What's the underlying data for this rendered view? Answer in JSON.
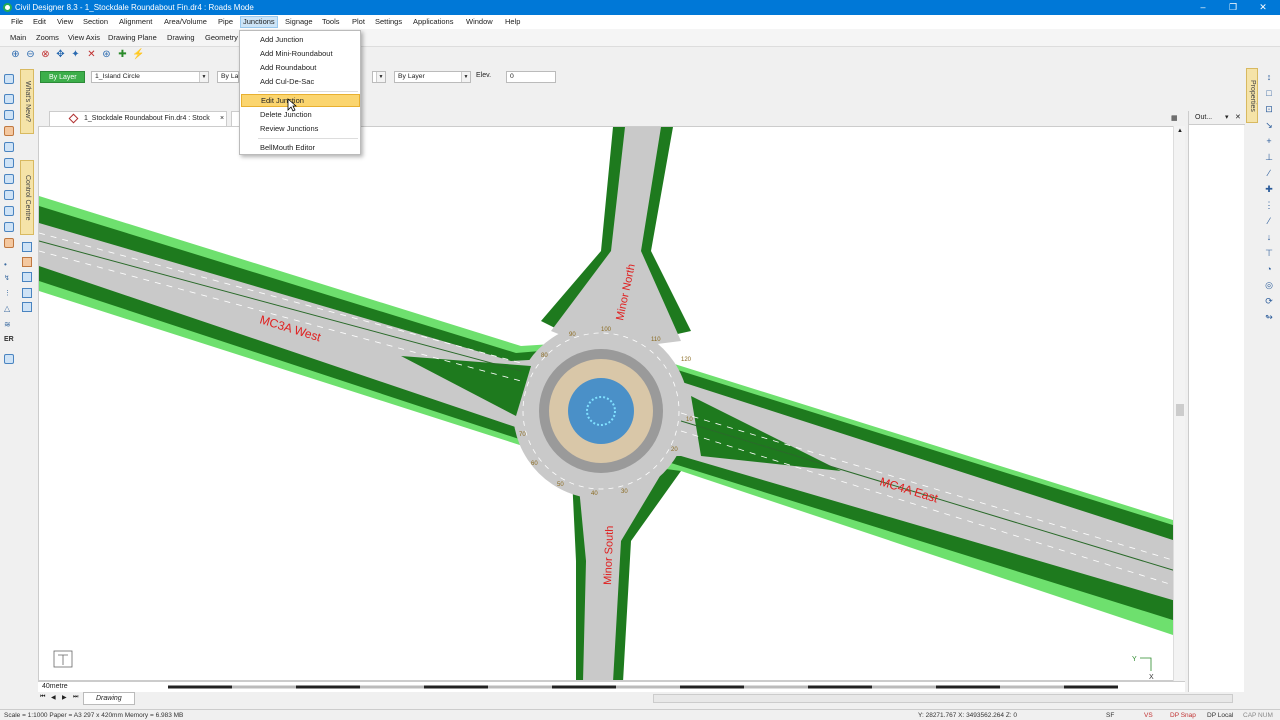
{
  "window": {
    "title": "Civil Designer 8.3 - 1_Stockdale Roundabout Fin.dr4 : Roads Mode",
    "controls": {
      "minimize": "–",
      "restore": "❐",
      "close": "✕"
    }
  },
  "menu": [
    "File",
    "Edit",
    "View",
    "Section",
    "Alignment",
    "Area/Volume",
    "Pipe",
    "Junctions",
    "Signage",
    "Tools",
    "Plot",
    "Settings",
    "Applications",
    "Window",
    "Help"
  ],
  "submenu": [
    "Main",
    "Zooms",
    "View Axis",
    "Drawing Plane",
    "Drawing",
    "Geometry"
  ],
  "properties_bar": {
    "layer_button": "By Layer",
    "layer_name": "1_Island Circle",
    "linetype_short": "By La",
    "lineweight": "By Layer",
    "elev_label": "Elev.",
    "elev_value": "0"
  },
  "side_tabs": {
    "whats_new": "What's New?",
    "control_centre": "Control Centre",
    "properties": "Properties"
  },
  "doc_tab": {
    "label": "1_Stockdale Roundabout Fin.dr4 : Stock",
    "close": "×"
  },
  "out_panel": {
    "title": "Out...",
    "pin": "▾",
    "close": "✕"
  },
  "junctions_menu": {
    "items": [
      "Add Junction",
      "Add Mini-Roundabout",
      "Add Roundabout",
      "Add Cul-De-Sac",
      "Edit Junction",
      "Delete Junction",
      "Review Junctions",
      "BellMouth Editor"
    ],
    "highlighted": "Edit Junction"
  },
  "drawing": {
    "road_labels": {
      "west": "MC3A West",
      "east": "MC4A East",
      "north": "Minor North",
      "south": "Minor South"
    },
    "colors": {
      "road": "#c9c9c9",
      "verge": "#1e7a1e",
      "outer_verge": "#6ee06e",
      "label": "#e02020",
      "roundabout_ring": "#9a9a9a",
      "island_water": "#4a90c8"
    },
    "chainage_labels": [
      "100",
      "110",
      "120",
      "10",
      "20",
      "30",
      "40",
      "50",
      "60",
      "70",
      "80",
      "90"
    ],
    "axis_glyph": {
      "y": "Y",
      "x": "X"
    }
  },
  "scale_label": "40metre",
  "sheet_tab": "Drawing",
  "status": {
    "left": "Scale = 1:1000  Paper = A3 297 x 420mm  Memory = 6.983 MB",
    "coords": "Y: 28271.767 X: 3493562.264 Z: 0",
    "sf": "SF",
    "vs": "VS",
    "dp_snap": "DP Snap",
    "dp_local": "DP Local",
    "caps_num": "CAP  NUM"
  }
}
